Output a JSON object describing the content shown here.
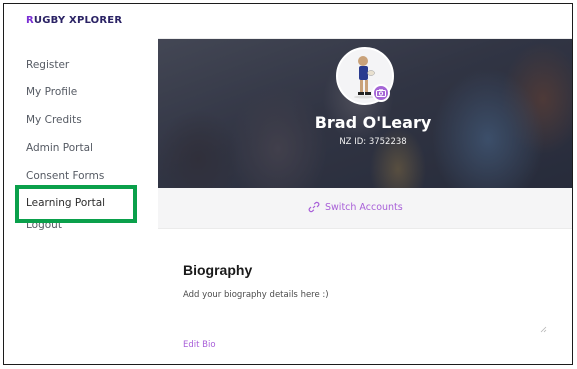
{
  "brand": {
    "first_letter": "R",
    "rest": "UGBY XPLORER"
  },
  "sidebar": {
    "items": [
      {
        "label": "Register"
      },
      {
        "label": "My Profile"
      },
      {
        "label": "My Credits"
      },
      {
        "label": "Admin Portal"
      },
      {
        "label": "Consent Forms"
      },
      {
        "label": "Learning Portal"
      },
      {
        "label": "Logout"
      }
    ],
    "highlight_color": "#0aa04b"
  },
  "profile": {
    "name": "Brad O'Leary",
    "nz_id": "NZ ID: 3752238",
    "avatar_icon": "rugby-player-avatar",
    "camera_icon": "camera-icon"
  },
  "switch_accounts": {
    "label": "Switch Accounts",
    "icon": "link-icon"
  },
  "biography": {
    "title": "Biography",
    "text": "Add your biography details here :)",
    "edit_label": "Edit Bio"
  },
  "colors": {
    "accent": "#a85fd8",
    "brand_dark": "#2b2365"
  }
}
